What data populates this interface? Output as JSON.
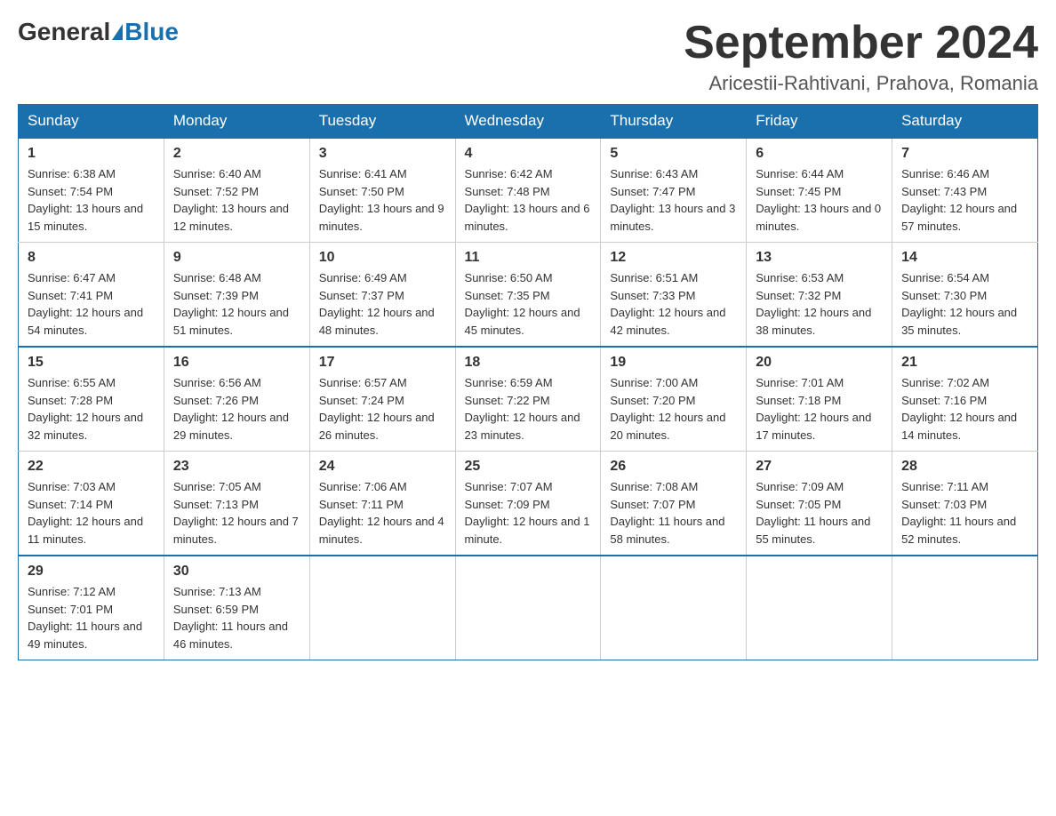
{
  "header": {
    "logo_general": "General",
    "logo_blue": "Blue",
    "month_title": "September 2024",
    "location": "Aricestii-Rahtivani, Prahova, Romania"
  },
  "days_of_week": [
    "Sunday",
    "Monday",
    "Tuesday",
    "Wednesday",
    "Thursday",
    "Friday",
    "Saturday"
  ],
  "weeks": [
    [
      {
        "num": "1",
        "sunrise": "6:38 AM",
        "sunset": "7:54 PM",
        "daylight": "13 hours and 15 minutes."
      },
      {
        "num": "2",
        "sunrise": "6:40 AM",
        "sunset": "7:52 PM",
        "daylight": "13 hours and 12 minutes."
      },
      {
        "num": "3",
        "sunrise": "6:41 AM",
        "sunset": "7:50 PM",
        "daylight": "13 hours and 9 minutes."
      },
      {
        "num": "4",
        "sunrise": "6:42 AM",
        "sunset": "7:48 PM",
        "daylight": "13 hours and 6 minutes."
      },
      {
        "num": "5",
        "sunrise": "6:43 AM",
        "sunset": "7:47 PM",
        "daylight": "13 hours and 3 minutes."
      },
      {
        "num": "6",
        "sunrise": "6:44 AM",
        "sunset": "7:45 PM",
        "daylight": "13 hours and 0 minutes."
      },
      {
        "num": "7",
        "sunrise": "6:46 AM",
        "sunset": "7:43 PM",
        "daylight": "12 hours and 57 minutes."
      }
    ],
    [
      {
        "num": "8",
        "sunrise": "6:47 AM",
        "sunset": "7:41 PM",
        "daylight": "12 hours and 54 minutes."
      },
      {
        "num": "9",
        "sunrise": "6:48 AM",
        "sunset": "7:39 PM",
        "daylight": "12 hours and 51 minutes."
      },
      {
        "num": "10",
        "sunrise": "6:49 AM",
        "sunset": "7:37 PM",
        "daylight": "12 hours and 48 minutes."
      },
      {
        "num": "11",
        "sunrise": "6:50 AM",
        "sunset": "7:35 PM",
        "daylight": "12 hours and 45 minutes."
      },
      {
        "num": "12",
        "sunrise": "6:51 AM",
        "sunset": "7:33 PM",
        "daylight": "12 hours and 42 minutes."
      },
      {
        "num": "13",
        "sunrise": "6:53 AM",
        "sunset": "7:32 PM",
        "daylight": "12 hours and 38 minutes."
      },
      {
        "num": "14",
        "sunrise": "6:54 AM",
        "sunset": "7:30 PM",
        "daylight": "12 hours and 35 minutes."
      }
    ],
    [
      {
        "num": "15",
        "sunrise": "6:55 AM",
        "sunset": "7:28 PM",
        "daylight": "12 hours and 32 minutes."
      },
      {
        "num": "16",
        "sunrise": "6:56 AM",
        "sunset": "7:26 PM",
        "daylight": "12 hours and 29 minutes."
      },
      {
        "num": "17",
        "sunrise": "6:57 AM",
        "sunset": "7:24 PM",
        "daylight": "12 hours and 26 minutes."
      },
      {
        "num": "18",
        "sunrise": "6:59 AM",
        "sunset": "7:22 PM",
        "daylight": "12 hours and 23 minutes."
      },
      {
        "num": "19",
        "sunrise": "7:00 AM",
        "sunset": "7:20 PM",
        "daylight": "12 hours and 20 minutes."
      },
      {
        "num": "20",
        "sunrise": "7:01 AM",
        "sunset": "7:18 PM",
        "daylight": "12 hours and 17 minutes."
      },
      {
        "num": "21",
        "sunrise": "7:02 AM",
        "sunset": "7:16 PM",
        "daylight": "12 hours and 14 minutes."
      }
    ],
    [
      {
        "num": "22",
        "sunrise": "7:03 AM",
        "sunset": "7:14 PM",
        "daylight": "12 hours and 11 minutes."
      },
      {
        "num": "23",
        "sunrise": "7:05 AM",
        "sunset": "7:13 PM",
        "daylight": "12 hours and 7 minutes."
      },
      {
        "num": "24",
        "sunrise": "7:06 AM",
        "sunset": "7:11 PM",
        "daylight": "12 hours and 4 minutes."
      },
      {
        "num": "25",
        "sunrise": "7:07 AM",
        "sunset": "7:09 PM",
        "daylight": "12 hours and 1 minute."
      },
      {
        "num": "26",
        "sunrise": "7:08 AM",
        "sunset": "7:07 PM",
        "daylight": "11 hours and 58 minutes."
      },
      {
        "num": "27",
        "sunrise": "7:09 AM",
        "sunset": "7:05 PM",
        "daylight": "11 hours and 55 minutes."
      },
      {
        "num": "28",
        "sunrise": "7:11 AM",
        "sunset": "7:03 PM",
        "daylight": "11 hours and 52 minutes."
      }
    ],
    [
      {
        "num": "29",
        "sunrise": "7:12 AM",
        "sunset": "7:01 PM",
        "daylight": "11 hours and 49 minutes."
      },
      {
        "num": "30",
        "sunrise": "7:13 AM",
        "sunset": "6:59 PM",
        "daylight": "11 hours and 46 minutes."
      },
      null,
      null,
      null,
      null,
      null
    ]
  ]
}
